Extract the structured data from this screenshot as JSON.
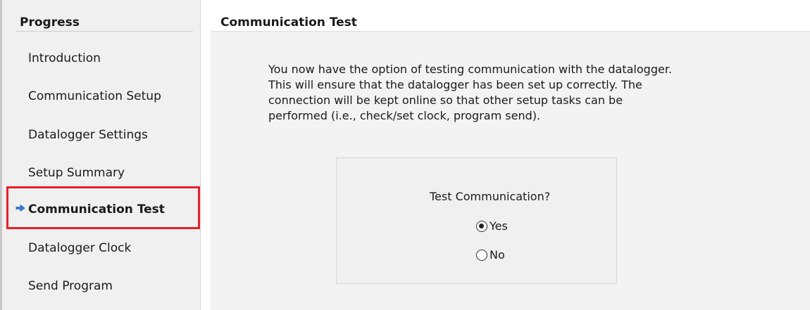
{
  "sidebar": {
    "title": "Progress",
    "steps": [
      {
        "label": "Introduction"
      },
      {
        "label": "Communication Setup"
      },
      {
        "label": "Datalogger Settings"
      },
      {
        "label": "Setup Summary"
      },
      {
        "label": "Communication Test",
        "current": true
      },
      {
        "label": "Datalogger Clock"
      },
      {
        "label": "Send Program"
      }
    ]
  },
  "main": {
    "title": "Communication Test",
    "description": "You now have the option of testing communication with the datalogger.\n This will ensure that the datalogger has been set up correctly.  The\nconnection will be kept online so that other setup tasks can be\nperformed (i.e., check/set clock, program send).",
    "test": {
      "question": "Test Communication?",
      "options": [
        {
          "label": "Yes",
          "selected": true
        },
        {
          "label": "No",
          "selected": false
        }
      ]
    }
  },
  "colors": {
    "highlight": "#e8202a",
    "current_arrow": "#3a7bd5"
  },
  "icons": {
    "current_step": "right-arrow-icon"
  }
}
